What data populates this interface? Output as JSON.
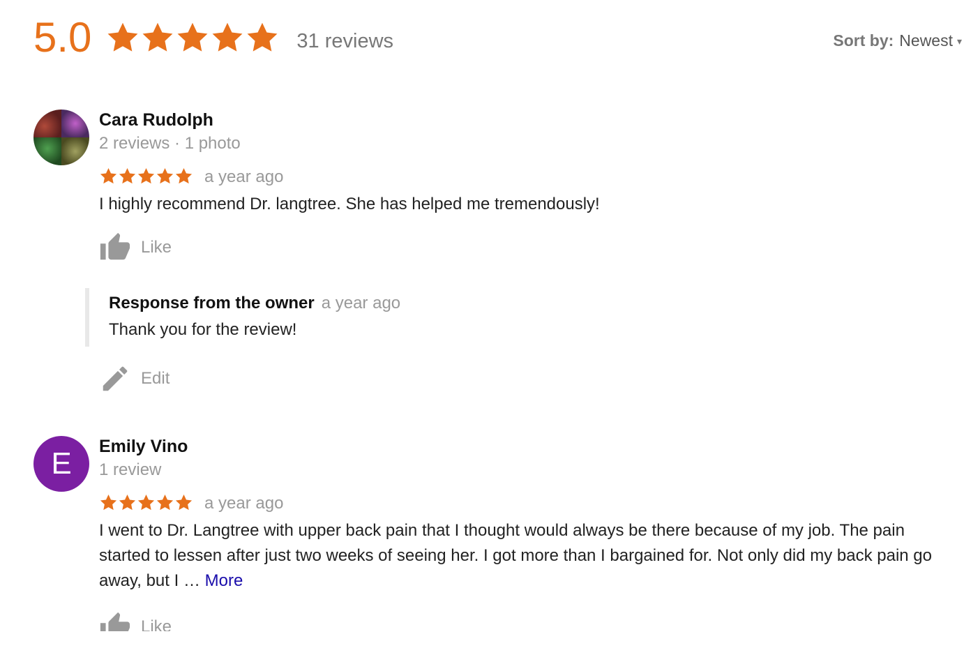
{
  "summary": {
    "score": "5.0",
    "stars": 5,
    "review_count": "31 reviews"
  },
  "sort": {
    "label": "Sort by:",
    "value": "Newest"
  },
  "colors": {
    "star": "#e7711b",
    "link": "#1a0dab",
    "avatar_e": "#7b1fa2"
  },
  "reviews": [
    {
      "name": "Cara Rudolph",
      "meta": "2 reviews · 1 photo",
      "stars": 5,
      "time": "a year ago",
      "text": "I highly recommend Dr. langtree. She has helped me tremendously!",
      "like_label": "Like",
      "avatar": "photo",
      "owner_response": {
        "title": "Response from the owner",
        "time": "a year ago",
        "text": "Thank you for the review!",
        "edit_label": "Edit"
      }
    },
    {
      "name": "Emily Vino",
      "meta": "1 review",
      "stars": 5,
      "time": "a year ago",
      "text": "I went to Dr. Langtree with upper back pain that I thought would always be there because of my job. The pain started to lessen after just two weeks of seeing her. I got more than I bargained for. Not only did my back pain go away, but I … ",
      "more_label": "More",
      "like_label": "Like",
      "avatar": "letter",
      "avatar_letter": "E"
    }
  ]
}
